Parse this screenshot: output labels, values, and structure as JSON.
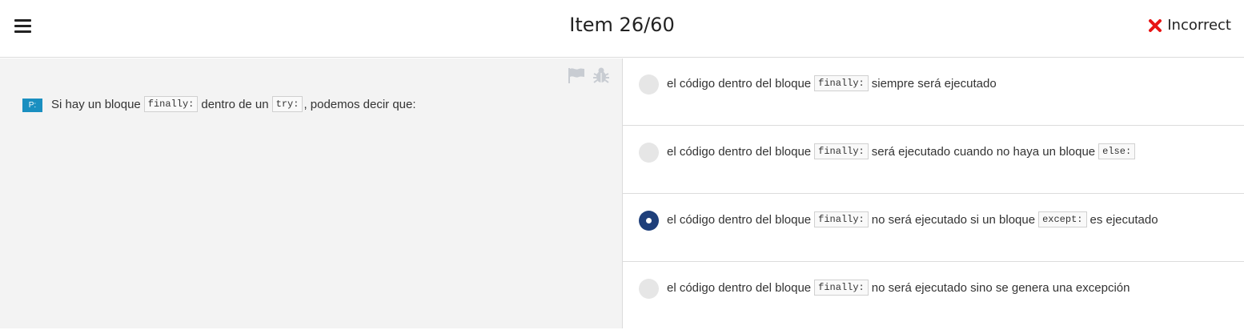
{
  "header": {
    "title": "Item 26/60",
    "status_label": "Incorrect",
    "status_color": "#e81414"
  },
  "question": {
    "badge": "P:",
    "parts": [
      "Si hay un bloque",
      "finally:",
      "dentro de un",
      "try:",
      ", podemos decir que:"
    ]
  },
  "options": [
    {
      "selected": false,
      "parts": [
        "el código dentro del bloque",
        "finally:",
        "siempre será ejecutado"
      ]
    },
    {
      "selected": false,
      "parts": [
        "el código dentro del bloque",
        "finally:",
        "será ejecutado cuando no haya un bloque",
        "else:"
      ]
    },
    {
      "selected": true,
      "parts": [
        "el código dentro del bloque",
        "finally:",
        "no será ejecutado si un bloque",
        "except:",
        "es ejecutado"
      ]
    },
    {
      "selected": false,
      "parts": [
        "el código dentro del bloque",
        "finally:",
        "no será ejecutado sino se genera una excepción"
      ]
    }
  ],
  "icons": {
    "menu": "hamburger-menu-icon",
    "status": "x-mark-icon",
    "flag": "flag-icon",
    "bug": "bug-icon"
  },
  "colors": {
    "badge": "#1a8fc0",
    "selected_radio": "#1e3f7a",
    "left_pane_bg": "#f3f3f3"
  }
}
